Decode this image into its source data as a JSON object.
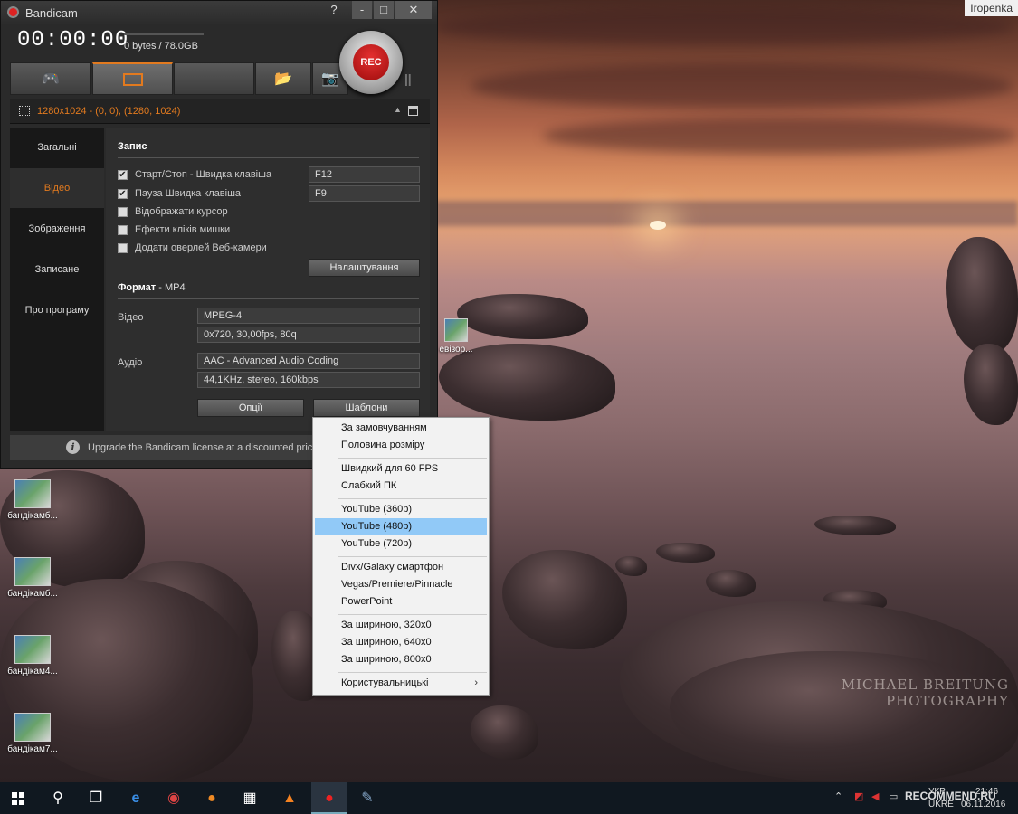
{
  "site_tag": "Iropenka",
  "wallpaper": {
    "watermark_line1": "MICHAEL BREITUNG",
    "watermark_line2": "PHOTOGRAPHY"
  },
  "desktop_icons": [
    {
      "label": "бандікамб..."
    },
    {
      "label": "бандікамб..."
    },
    {
      "label": "бандікам4..."
    },
    {
      "label": "бандікам7..."
    },
    {
      "label": "евізор..."
    }
  ],
  "window": {
    "title": "Bandicam",
    "help": "?",
    "minimize": "-",
    "maximize": "□",
    "close": "✕",
    "timer": "00:00:00",
    "filesize": "0 bytes / 78.0GB",
    "rec_label": "REC",
    "area_text": "1280x1024 - (0, 0), (1280, 1024)",
    "accent": "#e27a1f"
  },
  "nav": {
    "items": [
      {
        "label": "Загальні"
      },
      {
        "label": "Відео"
      },
      {
        "label": "Зображення"
      },
      {
        "label": "Записане"
      },
      {
        "label": "Про програму"
      }
    ],
    "active_index": 1
  },
  "record": {
    "heading": "Запис",
    "options": [
      {
        "label": "Старт/Стоп - Швидка клавіша",
        "checked": true,
        "hotkey": "F12"
      },
      {
        "label": "Пауза Швидка клавіша",
        "checked": true,
        "hotkey": "F9"
      },
      {
        "label": "Відображати курсор",
        "checked": false
      },
      {
        "label": "Ефекти кліків мишки",
        "checked": false
      },
      {
        "label": "Додати оверлей Веб-камери",
        "checked": false
      }
    ],
    "settings_button": "Налаштування"
  },
  "format": {
    "heading": "Формат",
    "heading_suffix": " - MP4",
    "video_label": "Відео",
    "video_codec": "MPEG-4",
    "video_params": "0x720, 30,00fps, 80q",
    "audio_label": "Аудіо",
    "audio_codec": "AAC - Advanced Audio Coding",
    "audio_params": "44,1KHz, stereo, 160kbps",
    "options_button": "Опції",
    "templates_button": "Шаблони"
  },
  "upgrade_text": "Upgrade the Bandicam license at a discounted price -",
  "context_menu": {
    "groups": [
      [
        "За замовчуванням",
        "Половина розміру"
      ],
      [
        "Швидкий для 60 FPS",
        "Слабкий ПК"
      ],
      [
        "YouTube (360p)",
        "YouTube (480p)",
        "YouTube (720p)"
      ],
      [
        "Divx/Galaxy смартфон",
        "Vegas/Premiere/Pinnacle",
        "PowerPoint"
      ],
      [
        "За шириною, 320x0",
        "За шириною, 640x0",
        "За шириною, 800x0"
      ],
      [
        "Користувальницькі"
      ]
    ],
    "highlighted": "YouTube (480p)",
    "highlight_color": "#91c9f7",
    "submenu_arrow": "›"
  },
  "taskbar": {
    "tray_lang_top": "УКР",
    "tray_lang": "UKRE",
    "time": "21:46",
    "date": "06.11.2016",
    "recommend": "RECOMMEND.RU"
  }
}
